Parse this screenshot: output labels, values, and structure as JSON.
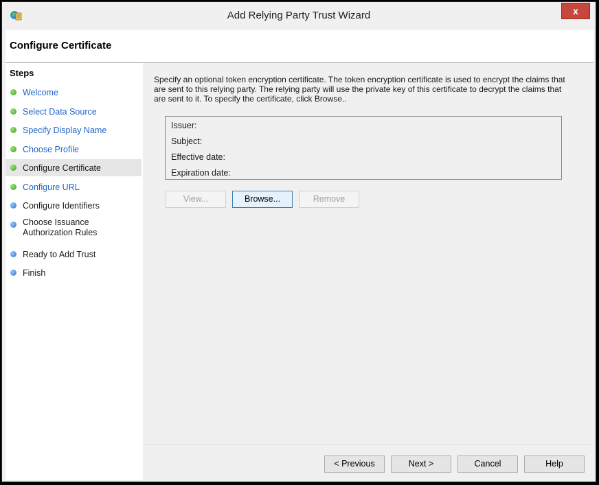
{
  "window": {
    "title": "Add Relying Party Trust Wizard",
    "close_label": "x"
  },
  "header": {
    "title": "Configure Certificate"
  },
  "steps": {
    "heading": "Steps",
    "items": [
      {
        "label": "Welcome",
        "status": "done"
      },
      {
        "label": "Select Data Source",
        "status": "done"
      },
      {
        "label": "Specify Display Name",
        "status": "done"
      },
      {
        "label": "Choose Profile",
        "status": "done"
      },
      {
        "label": "Configure Certificate",
        "status": "current"
      },
      {
        "label": "Configure URL",
        "status": "done"
      },
      {
        "label": "Configure Identifiers",
        "status": "pending"
      },
      {
        "label": "Choose Issuance Authorization Rules",
        "status": "pending"
      },
      {
        "label": "Ready to Add Trust",
        "status": "pending"
      },
      {
        "label": "Finish",
        "status": "pending"
      }
    ]
  },
  "content": {
    "description": "Specify an optional token encryption certificate.  The token encryption certificate is used to encrypt the claims that are sent to this relying party.  The relying party will use the private key of this certificate to decrypt the claims that are sent to it.  To specify the certificate, click Browse..",
    "cert_fields": {
      "issuer": "Issuer:",
      "subject": "Subject:",
      "effective": "Effective date:",
      "expiration": "Expiration date:"
    },
    "buttons": {
      "view": "View...",
      "browse": "Browse...",
      "remove": "Remove"
    }
  },
  "footer": {
    "previous": "< Previous",
    "next": "Next >",
    "cancel": "Cancel",
    "help": "Help"
  },
  "colors": {
    "link": "#1e64c8",
    "done_dot": "#3aa21e",
    "pending_dot": "#2a73d8",
    "close_button": "#c7463d"
  }
}
